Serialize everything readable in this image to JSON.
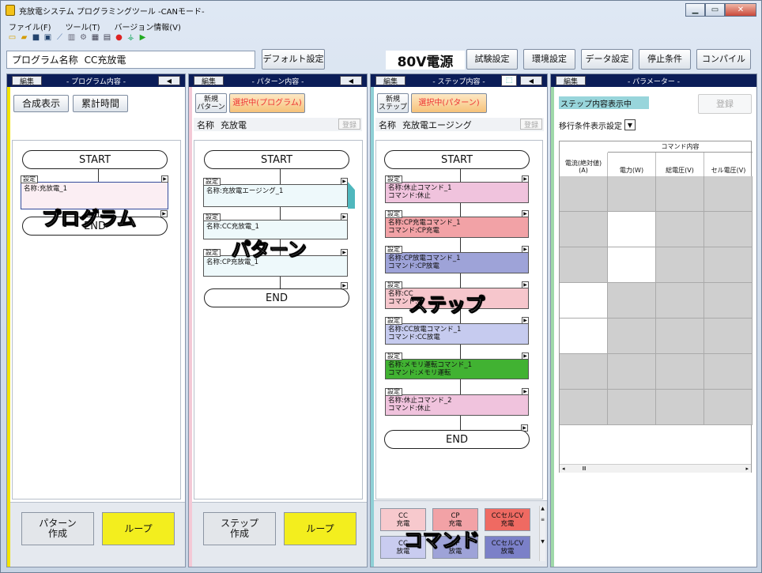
{
  "window": {
    "title": "充放電システム プログラミングツール -CANモード-",
    "min": "▁",
    "max": "▭",
    "close": "✕"
  },
  "menus": [
    "ファイル(F)",
    "ツール(T)",
    "バージョン情報(V)"
  ],
  "toolbar_icons": [
    "new-icon",
    "open-icon",
    "save-icon",
    "save-as-icon",
    "link-icon",
    "column-icon",
    "gear-icon",
    "grid-icon",
    "window-icon",
    "record-icon",
    "plug-icon",
    "run-icon"
  ],
  "program": {
    "label": "プログラム名称",
    "name": "CC充放電"
  },
  "buttons": {
    "default_settings": "デフォルト設定",
    "power": "80V電源",
    "test_settings": "試験設定",
    "env_settings": "環境設定",
    "data_settings": "データ設定",
    "stop_conditions": "停止条件",
    "compile": "コンパイル"
  },
  "panel_program": {
    "edit": "編集",
    "title": "- プログラム内容 -",
    "collapse": "◀",
    "composite": "合成表示",
    "cumulative": "累計時間",
    "start": "START",
    "end": "END",
    "node": {
      "set": "設定",
      "text": "名称:充放電_1"
    },
    "overlay": "プログラム",
    "pattern_btn": "パターン\n作成",
    "loop": "ループ"
  },
  "panel_pattern": {
    "edit": "編集",
    "title": "- パターン内容 -",
    "collapse": "◀",
    "new_btn": "新規\nパターン",
    "selected": "選択中(プログラム)",
    "name_label": "名称",
    "name": "充放電",
    "register": "登録",
    "start": "START",
    "end": "END",
    "nodes": [
      {
        "set": "設定",
        "text": "名称:充放電エージング_1"
      },
      {
        "set": "設定",
        "text": "名称:CC充放電_1"
      },
      {
        "set": "設定",
        "text": "名称:CP充放電_1"
      }
    ],
    "overlay": "パターン",
    "step_btn": "ステップ\n作成",
    "loop": "ループ"
  },
  "panel_step": {
    "edit": "編集",
    "title": "- ステップ内容 -",
    "collapse": "◀",
    "new_btn": "新規\nステップ",
    "selected": "選択中(パターン)",
    "name_label": "名称",
    "name": "充放電エージング",
    "register": "登録",
    "start": "START",
    "end": "END",
    "nodes": [
      {
        "set": "設定",
        "l1": "名称:休止コマンド_1",
        "l2": "コマンド:休止",
        "color": "#f0c3dd"
      },
      {
        "set": "設定",
        "l1": "名称:CP充電コマンド_1",
        "l2": "コマンド:CP充電",
        "color": "#f2a2a6"
      },
      {
        "set": "設定",
        "l1": "名称:CP放電コマンド_1",
        "l2": "コマンド:CP放電",
        "color": "#9ea3d8"
      },
      {
        "set": "設定",
        "l1": "名称:CC",
        "l2": "コマンド:C",
        "color": "#f6c6cc"
      },
      {
        "set": "設定",
        "l1": "名称:CC放電コマンド_1",
        "l2": "コマンド:CC放電",
        "color": "#c6cbef"
      },
      {
        "set": "設定",
        "l1": "名称:メモリ運転コマンド_1",
        "l2": "コマンド:メモリ運転",
        "color": "#41b232"
      },
      {
        "set": "設定",
        "l1": "名称:休止コマンド_2",
        "l2": "コマンド:休止",
        "color": "#f0c3dd"
      }
    ],
    "overlay_step": "ステップ",
    "overlay_cmd": "コマンド",
    "commands": [
      {
        "label": "CC\n充電",
        "color": "#f7c9cd"
      },
      {
        "label": "CP\n充電",
        "color": "#f2a2a6"
      },
      {
        "label": "CCセルCV\n充電",
        "color": "#ef6a62"
      },
      {
        "label": "CC\n放電",
        "color": "#c9ccf0"
      },
      {
        "label": "CP\n放電",
        "color": "#9ea3d8"
      },
      {
        "label": "CCセルCV\n放電",
        "color": "#7b80c8"
      }
    ]
  },
  "panel_param": {
    "edit": "編集",
    "title": "- パラメーター -",
    "status": "ステップ内容表示中",
    "register": "登録",
    "transition": "移行条件表示設定",
    "group_header": "コマンド内容",
    "columns": [
      "電流(絶対値)\n(A)",
      "電力(W)",
      "総電圧(V)",
      "セル電圧(V)"
    ],
    "scroll": "Ⅲ"
  }
}
